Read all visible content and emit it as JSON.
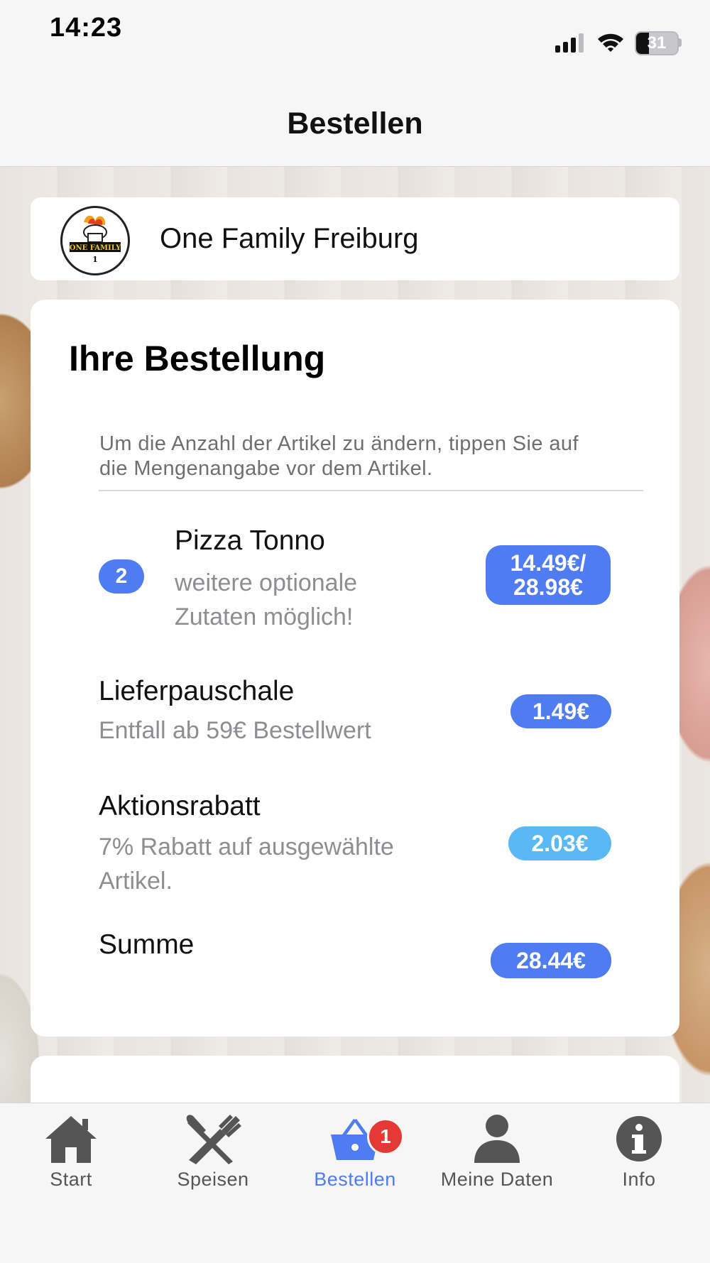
{
  "status": {
    "time": "14:23",
    "battery": "31",
    "battery_level": 0.31
  },
  "header": {
    "title": "Bestellen"
  },
  "restaurant": {
    "name": "One Family Freiburg",
    "logo_text": "ONE FAMILY"
  },
  "order": {
    "title": "Ihre Bestellung",
    "hint": "Um die Anzahl der Artikel zu ändern, tippen Sie auf die Mengenangabe vor dem Artikel.",
    "items": [
      {
        "quantity": "2",
        "name": "Pizza Tonno",
        "subtitle": "weitere optionale Zutaten möglich!",
        "price_line1": "14.49€/",
        "price_line2": "28.98€"
      }
    ],
    "delivery": {
      "name": "Lieferpauschale",
      "subtitle": "Entfall ab 59€ Bestellwert",
      "price": "1.49€"
    },
    "discount": {
      "name": "Aktionsrabatt",
      "subtitle": "7% Rabatt auf ausgewählte Artikel.",
      "price": "2.03€"
    },
    "total": {
      "name": "Summe",
      "price": "28.44€"
    }
  },
  "colors": {
    "accent": "#4f7cf0",
    "discount": "#5ab8f5",
    "badge": "#e53935",
    "icon": "#555555"
  },
  "tabs": [
    {
      "label": "Start",
      "icon": "home-icon"
    },
    {
      "label": "Speisen",
      "icon": "fork-knife-icon"
    },
    {
      "label": "Bestellen",
      "icon": "basket-icon",
      "badge": "1",
      "active": true
    },
    {
      "label": "Meine Daten",
      "icon": "person-icon"
    },
    {
      "label": "Info",
      "icon": "info-icon"
    }
  ]
}
